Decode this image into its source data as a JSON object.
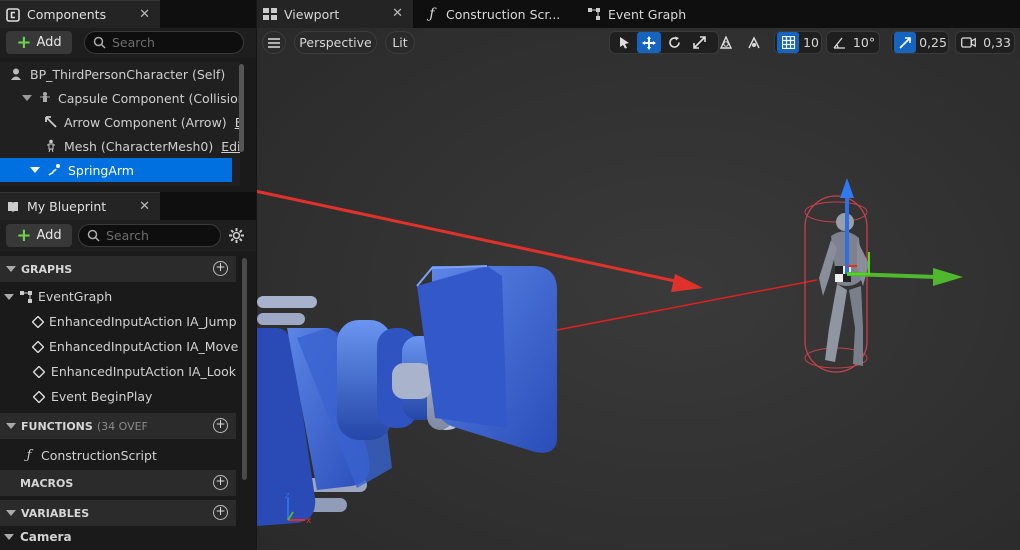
{
  "components_panel": {
    "tab_label": "Components",
    "add_label": "Add",
    "search_placeholder": "Search",
    "tree": [
      {
        "label": "BP_ThirdPersonCharacter (Self)",
        "edit": ""
      },
      {
        "label": "Capsule Component (CollisionC",
        "edit": ""
      },
      {
        "label": "Arrow Component (Arrow)",
        "edit": "E"
      },
      {
        "label": "Mesh (CharacterMesh0)",
        "edit": "Edi"
      },
      {
        "label": "SpringArm",
        "edit": ""
      }
    ]
  },
  "blueprint_panel": {
    "tab_label": "My Blueprint",
    "add_label": "Add",
    "search_placeholder": "Search",
    "sections": {
      "graphs": "GRAPHS",
      "functions": "FUNCTIONS",
      "functions_sub": "(34 OVEF",
      "macros": "MACROS",
      "variables": "VARIABLES"
    },
    "graphs": {
      "event_graph": "EventGraph",
      "events": [
        "EnhancedInputAction IA_Jump",
        "EnhancedInputAction IA_Move",
        "EnhancedInputAction IA_Look",
        "Event BeginPlay"
      ]
    },
    "functions": [
      "ConstructionScript"
    ],
    "variable_categories": [
      "Camera"
    ]
  },
  "doc_tabs": [
    "Viewport",
    "Construction Scr...",
    "Event Graph"
  ],
  "viewport_toolbar": {
    "perspective": "Perspective",
    "lit": "Lit",
    "grid_snap": "10",
    "rotation_snap": "10°",
    "scale_snap": "0,25",
    "camera_speed": "0,33"
  },
  "colors": {
    "accent": "#0070e0",
    "active_toggle": "#1565c0",
    "add_plus": "#6ed34a",
    "annotation_arrow": "#e0322a"
  }
}
